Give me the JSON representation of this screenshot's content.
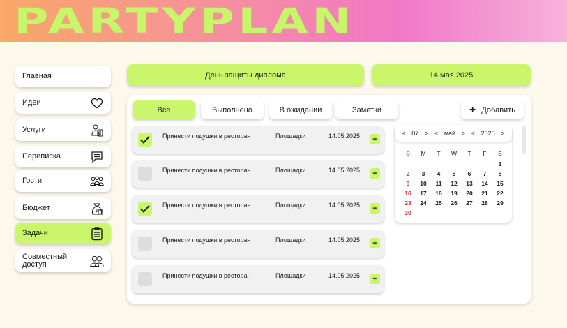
{
  "app": {
    "logo": "PARTYPLAN",
    "accent": "#cbf66c"
  },
  "sidebar": {
    "items": [
      {
        "label": "Главная",
        "icon": ""
      },
      {
        "label": "Идеи",
        "icon": "heart-icon"
      },
      {
        "label": "Услуги",
        "icon": "services-icon"
      },
      {
        "label": "Переписка",
        "icon": "chat-icon"
      },
      {
        "label": "Гости",
        "icon": "guests-icon"
      },
      {
        "label": "Бюджет",
        "icon": "budget-icon"
      },
      {
        "label": "Задачи",
        "icon": "clipboard-icon"
      },
      {
        "label": "Совместный доступ",
        "icon": "shared-access-icon"
      }
    ]
  },
  "event": {
    "name": "День защиты диплома",
    "date": "14 мая 2025"
  },
  "tabs": [
    "Все",
    "Выполнено",
    "В ожидании",
    "Заметки"
  ],
  "add_label": "Добавить",
  "tasks": [
    {
      "title": "Принести подушки в ресторан",
      "category": "Площадки",
      "date": "14.05.2025",
      "done": true
    },
    {
      "title": "Принести подушки в ресторан",
      "category": "Площадки",
      "date": "14.05.2025",
      "done": false
    },
    {
      "title": "Принести подушки в ресторан",
      "category": "Площадки",
      "date": "14.05.2025",
      "done": true
    },
    {
      "title": "Принести подушки в ресторан",
      "category": "Площадки",
      "date": "14.05.2025",
      "done": false
    },
    {
      "title": "Принести подушки в ресторан",
      "category": "Площадки",
      "date": "14.05.2025",
      "done": false
    }
  ],
  "calendar": {
    "month_num": "07",
    "month_name": "май",
    "year": "2025",
    "weekdays": [
      "S",
      "M",
      "T",
      "W",
      "T",
      "F",
      "S"
    ],
    "weeks": [
      [
        "",
        "",
        "",
        "",
        "",
        "",
        "1"
      ],
      [
        "2",
        "3",
        "4",
        "5",
        "6",
        "7",
        "8"
      ],
      [
        "9",
        "10",
        "11",
        "12",
        "13",
        "14",
        "15"
      ],
      [
        "16",
        "17",
        "18",
        "19",
        "20",
        "21",
        "22"
      ],
      [
        "23",
        "24",
        "25",
        "26",
        "27",
        "28",
        "29"
      ],
      [
        "30",
        "",
        "",
        "",
        "",
        "",
        ""
      ]
    ],
    "sunday_color": "#d32b2b"
  }
}
